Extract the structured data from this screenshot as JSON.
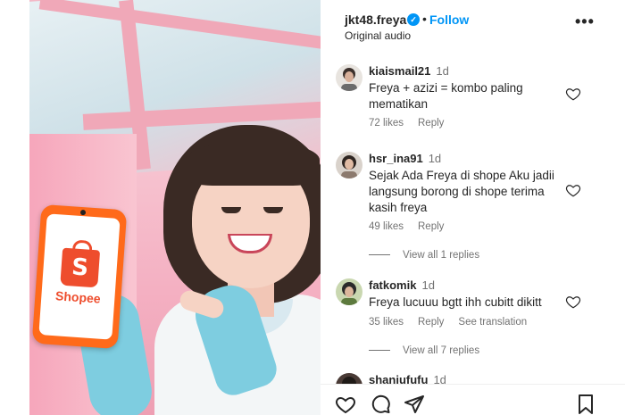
{
  "post": {
    "username": "jkt48.freya",
    "verified_mark": "✓",
    "separator": "•",
    "follow_label": "Follow",
    "audio": "Original audio",
    "more_label": "•••"
  },
  "media": {
    "brand": "Shopee",
    "bag_letter": "S",
    "brand_color": "#ee4d2d"
  },
  "comments": [
    {
      "user": "kiaismail21",
      "time": "1d",
      "text": "Freya + azizi = kombo paling mematikan",
      "likes": "72 likes",
      "reply": "Reply",
      "avatar_color": "#6b6b6b"
    },
    {
      "user": "hsr_ina91",
      "time": "1d",
      "text": "Sejak Ada Freya di shope Aku jadii langsung borong di shope terima kasih freya",
      "likes": "49 likes",
      "reply": "Reply",
      "view_replies": "View all 1 replies",
      "avatar_color": "#8c7a6e"
    },
    {
      "user": "fatkomik",
      "time": "1d",
      "text": "Freya lucuuu bgtt ihh cubitt dikitt",
      "likes": "35 likes",
      "reply": "Reply",
      "see_translation": "See translation",
      "view_replies": "View all 7 replies",
      "avatar_color": "#5d7a3e"
    },
    {
      "user": "shaniufufu",
      "time": "1d",
      "avatar_color": "#4a3b36"
    }
  ],
  "footer": {
    "icons": [
      "heart-icon",
      "comment-icon",
      "share-icon",
      "bookmark-icon"
    ]
  },
  "colors": {
    "accent": "#0095f6",
    "text": "#262626",
    "muted": "#737373"
  }
}
